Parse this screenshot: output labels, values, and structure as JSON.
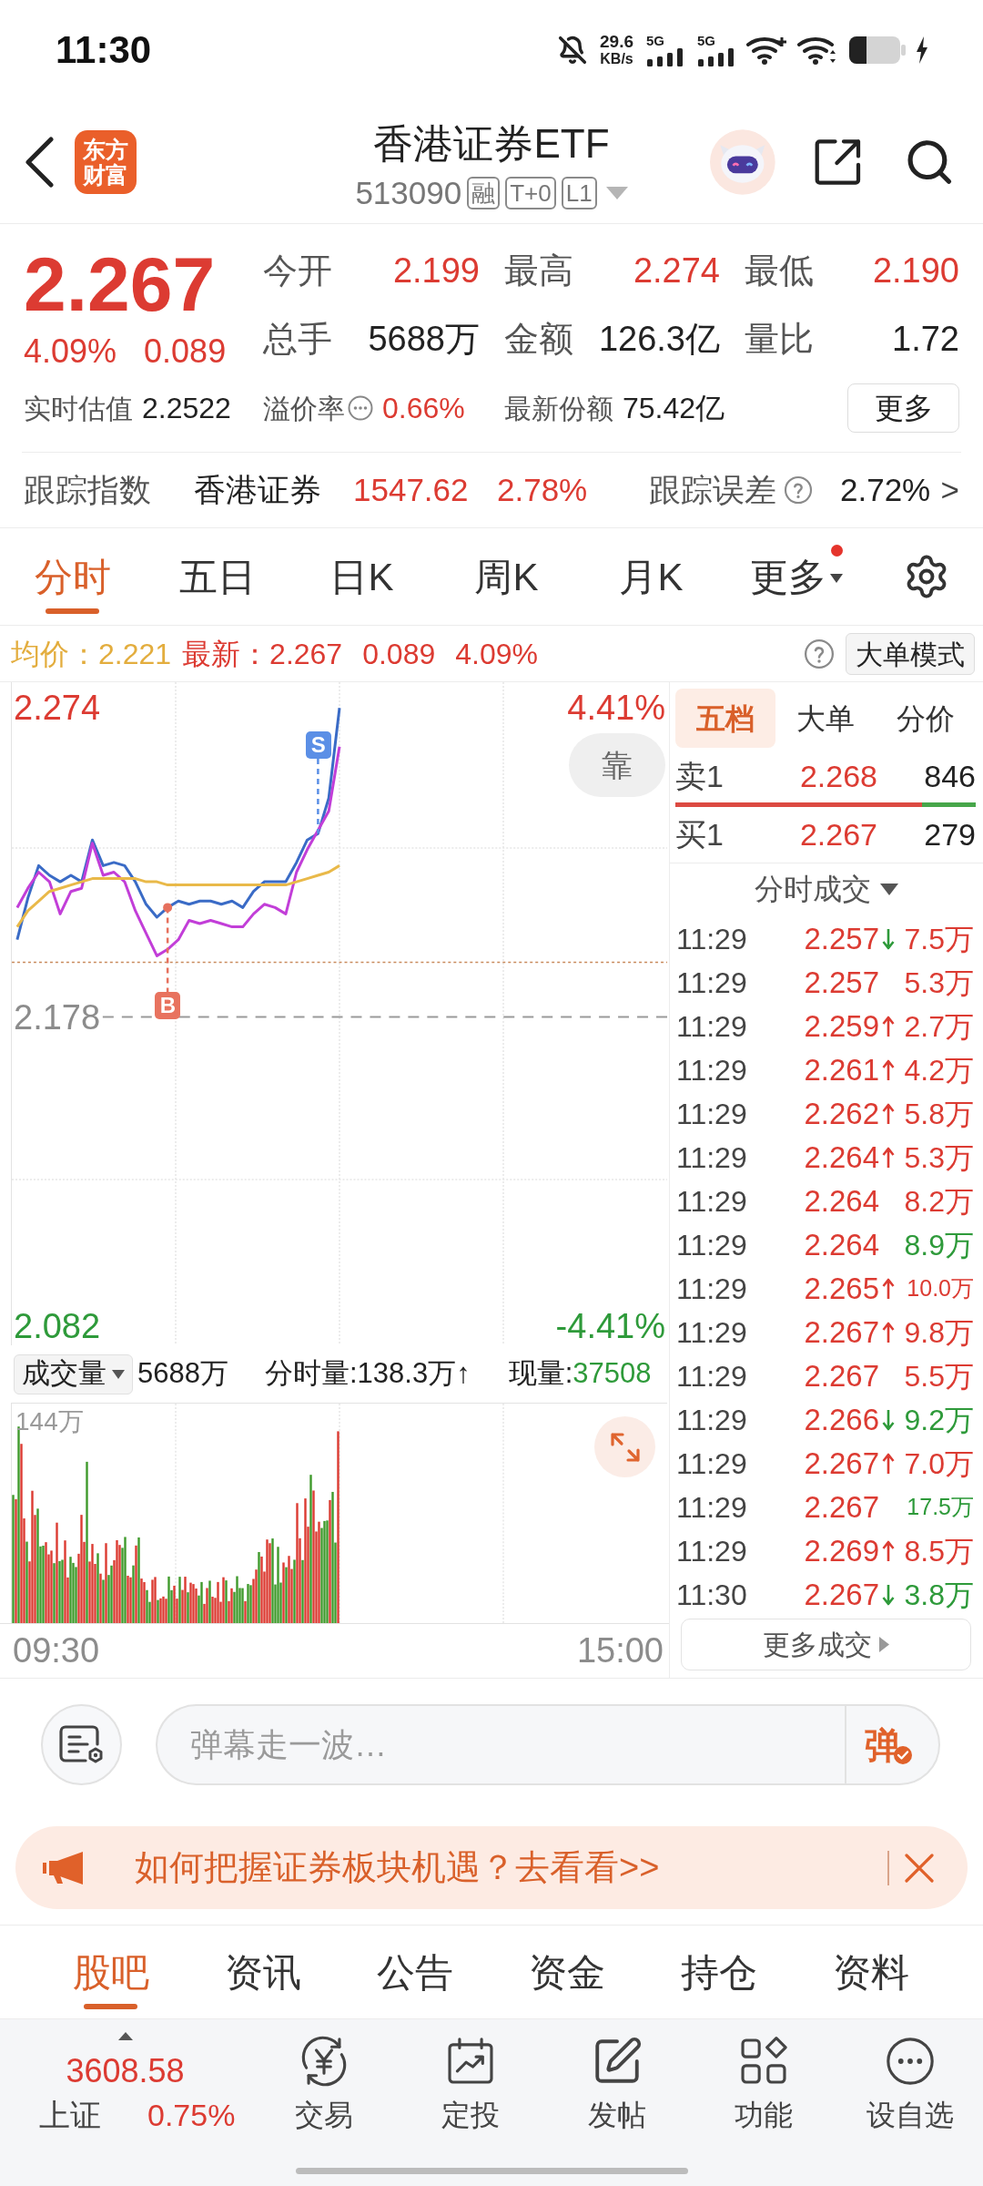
{
  "status_bar": {
    "time": "11:30",
    "net_speed": "29.6",
    "net_speed_unit": "KB/s",
    "signals": [
      "5G",
      "5G"
    ]
  },
  "header": {
    "logo": [
      "东方",
      "财富"
    ],
    "title": "香港证券ETF",
    "code": "513090",
    "badges": [
      "融",
      "T+0",
      "L1"
    ]
  },
  "quote": {
    "price": "2.267",
    "change_pct": "4.09%",
    "change": "0.089",
    "stats": [
      {
        "label": "今开",
        "value": "2.199",
        "color": "#dc3b32"
      },
      {
        "label": "最高",
        "value": "2.274",
        "color": "#dc3b32"
      },
      {
        "label": "最低",
        "value": "2.190",
        "color": "#dc3b32"
      },
      {
        "label": "总手",
        "value": "5688万",
        "color": "#222222"
      },
      {
        "label": "金额",
        "value": "126.3亿",
        "color": "#222222"
      },
      {
        "label": "量比",
        "value": "1.72",
        "color": "#222222"
      }
    ],
    "details": [
      {
        "label": "实时估值",
        "value": "2.2522",
        "color": "#222222",
        "dots_icon": false
      },
      {
        "label": "溢价率",
        "value": "0.66%",
        "color": "#dc3b32",
        "dots_icon": true
      },
      {
        "label": "最新份额",
        "value": "75.42亿",
        "color": "#222222",
        "dots_icon": false
      }
    ],
    "more_button": "更多"
  },
  "tracking": {
    "label": "跟踪指数",
    "index_name": "香港证券",
    "index_value": "1547.62",
    "index_change": "2.78%",
    "error_label": "跟踪误差",
    "error_value": "2.72%",
    "chevron": ">"
  },
  "chart_tabs": [
    {
      "label": "分时",
      "selected": true,
      "dropdown": false,
      "dot": false
    },
    {
      "label": "五日",
      "selected": false,
      "dropdown": false,
      "dot": false
    },
    {
      "label": "日K",
      "selected": false,
      "dropdown": false,
      "dot": false
    },
    {
      "label": "周K",
      "selected": false,
      "dropdown": false,
      "dot": false
    },
    {
      "label": "月K",
      "selected": false,
      "dropdown": false,
      "dot": false
    },
    {
      "label": "更多",
      "selected": false,
      "dropdown": true,
      "dot": true
    }
  ],
  "chart_info": {
    "average": "均价：2.221",
    "latest": "最新：2.267",
    "change": "0.089",
    "change_pct": "4.09%",
    "mode_button": "大单模式"
  },
  "price_chart": {
    "dock_button": "靠",
    "right_labels": [
      {
        "text": "4.41%",
        "color": "#dc3b32"
      },
      {
        "text": "-4.41%",
        "color": "#2e9a3a"
      }
    ],
    "chart_data": {
      "type": "line",
      "categories": [
        null,
        null,
        null,
        null,
        null,
        null,
        null,
        null,
        null,
        null,
        null,
        null,
        null,
        null,
        null,
        null,
        null,
        null,
        null,
        null,
        null,
        null,
        null,
        null,
        null,
        null,
        null,
        null,
        null,
        null,
        null,
        null,
        null,
        null,
        null,
        null,
        null,
        null,
        null,
        null,
        null,
        null,
        null,
        null,
        null,
        null,
        null,
        null,
        null,
        null,
        null,
        null,
        null,
        null,
        null,
        null,
        null,
        null,
        null,
        null,
        null
      ],
      "ylim": [
        2.076,
        2.282
      ],
      "yticks": [
        {
          "value": 2.274,
          "label": "2.274"
        },
        {
          "value": 2.178,
          "label": "2.178"
        },
        {
          "value": 2.082,
          "label": "2.082"
        }
      ],
      "series": [
        {
          "color": "#3a6bc6",
          "values": [
            2.202,
            2.215,
            2.225,
            2.222,
            2.22,
            2.222,
            2.22,
            2.233,
            2.225,
            2.226,
            2.225,
            2.22,
            2.213,
            2.209,
            2.212,
            2.214,
            2.213,
            2.214,
            2.214,
            2.213,
            2.214,
            2.212,
            2.217,
            2.22,
            2.22,
            2.22,
            2.226,
            2.233,
            2.235,
            2.246,
            2.274,
            null,
            null,
            null,
            null,
            null,
            null,
            null,
            null,
            null,
            null,
            null,
            null,
            null,
            null,
            null,
            null,
            null,
            null,
            null,
            null,
            null,
            null,
            null,
            null,
            null,
            null,
            null,
            null,
            null,
            null
          ]
        },
        {
          "color": "#c23ed8",
          "values": [
            2.212,
            2.218,
            2.223,
            2.22,
            2.21,
            2.217,
            2.218,
            2.232,
            2.222,
            2.223,
            2.22,
            2.211,
            2.204,
            2.197,
            2.199,
            2.202,
            2.208,
            2.207,
            2.208,
            2.207,
            2.206,
            2.206,
            2.21,
            2.213,
            2.212,
            2.21,
            2.223,
            2.23,
            2.236,
            2.242,
            2.262,
            null,
            null,
            null,
            null,
            null,
            null,
            null,
            null,
            null,
            null,
            null,
            null,
            null,
            null,
            null,
            null,
            null,
            null,
            null,
            null,
            null,
            null,
            null,
            null,
            null,
            null,
            null,
            null,
            null,
            null
          ]
        },
        {
          "color": "#e9b949",
          "values": [
            2.206,
            2.211,
            2.214,
            2.217,
            2.218,
            2.219,
            2.22,
            2.221,
            2.221,
            2.221,
            2.221,
            2.221,
            2.22,
            2.22,
            2.219,
            2.219,
            2.219,
            2.219,
            2.219,
            2.219,
            2.219,
            2.219,
            2.219,
            2.219,
            2.219,
            2.219,
            2.22,
            2.221,
            2.222,
            2.223,
            2.225,
            null,
            null,
            null,
            null,
            null,
            null,
            null,
            null,
            null,
            null,
            null,
            null,
            null,
            null,
            null,
            null,
            null,
            null,
            null,
            null,
            null,
            null,
            null,
            null,
            null,
            null,
            null,
            null,
            null,
            null
          ]
        }
      ],
      "annotations": [
        "B",
        "S"
      ],
      "ref_lines": [
        {
          "axis": "y",
          "value": 2.178
        },
        {
          "axis": "y",
          "value": 2.195
        }
      ]
    }
  },
  "volume_chart": {
    "selector": "成交量",
    "total": "5688万",
    "minute_volume": "分时量:138.3万↑",
    "current_label": "现量:",
    "current_value": "37508",
    "max_label": "144万",
    "time_axis": [
      "09:30",
      "15:00"
    ]
  },
  "order_book": {
    "tabs": [
      {
        "label": "五档",
        "selected": true
      },
      {
        "label": "大单",
        "selected": false
      },
      {
        "label": "分价",
        "selected": false
      }
    ],
    "levels": [
      {
        "label": "卖1",
        "price": "2.268",
        "volume": "846"
      },
      {
        "label": "买1",
        "price": "2.267",
        "volume": "279"
      }
    ],
    "ratio_bar": {
      "level": 0.82
    },
    "trades_title": "分时成交",
    "trades": [
      {
        "time": "11:29",
        "price": "2.257",
        "kind": "down",
        "volume": "7.5万",
        "color": "#dc3b32"
      },
      {
        "time": "11:29",
        "price": "2.257",
        "kind": "flat",
        "volume": "5.3万",
        "color": "#dc3b32"
      },
      {
        "time": "11:29",
        "price": "2.259",
        "kind": "up",
        "volume": "2.7万",
        "color": "#dc3b32"
      },
      {
        "time": "11:29",
        "price": "2.261",
        "kind": "up",
        "volume": "4.2万",
        "color": "#dc3b32"
      },
      {
        "time": "11:29",
        "price": "2.262",
        "kind": "up",
        "volume": "5.8万",
        "color": "#dc3b32"
      },
      {
        "time": "11:29",
        "price": "2.264",
        "kind": "up",
        "volume": "5.3万",
        "color": "#dc3b32"
      },
      {
        "time": "11:29",
        "price": "2.264",
        "kind": "flat",
        "volume": "8.2万",
        "color": "#dc3b32"
      },
      {
        "time": "11:29",
        "price": "2.264",
        "kind": "flat",
        "volume": "8.9万",
        "color": "#2e9a3a"
      },
      {
        "time": "11:29",
        "price": "2.265",
        "kind": "up",
        "volume": "10.0万",
        "color": "#dc3b32"
      },
      {
        "time": "11:29",
        "price": "2.267",
        "kind": "up",
        "volume": "9.8万",
        "color": "#dc3b32"
      },
      {
        "time": "11:29",
        "price": "2.267",
        "kind": "flat",
        "volume": "5.5万",
        "color": "#dc3b32"
      },
      {
        "time": "11:29",
        "price": "2.266",
        "kind": "down",
        "volume": "9.2万",
        "color": "#2e9a3a"
      },
      {
        "time": "11:29",
        "price": "2.267",
        "kind": "up",
        "volume": "7.0万",
        "color": "#dc3b32"
      },
      {
        "time": "11:29",
        "price": "2.267",
        "kind": "flat",
        "volume": "17.5万",
        "color": "#2e9a3a"
      },
      {
        "time": "11:29",
        "price": "2.269",
        "kind": "up",
        "volume": "8.5万",
        "color": "#dc3b32"
      },
      {
        "time": "11:30",
        "price": "2.267",
        "kind": "down",
        "volume": "3.8万",
        "color": "#2e9a3a"
      }
    ],
    "more_button": "更多成交"
  },
  "comment_bar": {
    "placeholder": "弹幕走一波…",
    "send_button": "弹"
  },
  "banner": {
    "text": "如何把握证券板块机遇？去看看>>"
  },
  "bottom_tabs": [
    {
      "label": "股吧",
      "selected": true
    },
    {
      "label": "资讯",
      "selected": false
    },
    {
      "label": "公告",
      "selected": false
    },
    {
      "label": "资金",
      "selected": false
    },
    {
      "label": "持仓",
      "selected": false
    },
    {
      "label": "资料",
      "selected": false
    }
  ],
  "bottom_bar": {
    "index": {
      "value": "3608.58",
      "name": "上证",
      "change": "0.75%"
    },
    "items": [
      {
        "label": "交易",
        "kind": "trade"
      },
      {
        "label": "定投",
        "kind": "plan"
      },
      {
        "label": "发帖",
        "kind": "post"
      },
      {
        "label": "功能",
        "kind": "tools"
      },
      {
        "label": "设自选",
        "kind": "more"
      }
    ]
  }
}
